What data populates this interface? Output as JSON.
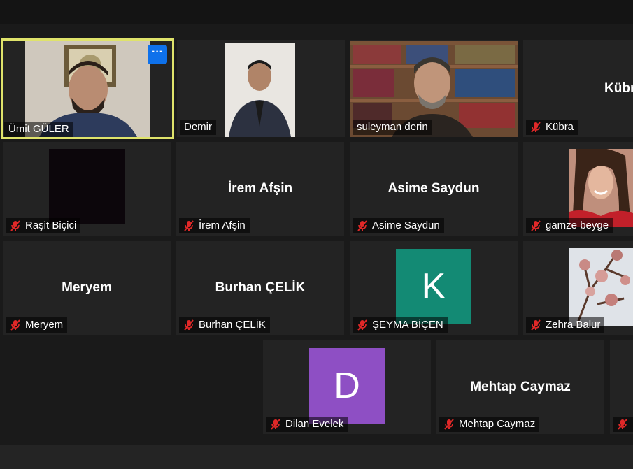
{
  "participants": {
    "umit": {
      "label": "Ümit GÜLER"
    },
    "demir": {
      "label": "Demir"
    },
    "suleyman": {
      "label": "suleyman derin"
    },
    "kubra": {
      "label": "Kübra",
      "center": "Kübra"
    },
    "rasit": {
      "label": "Raşit Biçici"
    },
    "irem": {
      "label": "İrem Afşin",
      "center": "İrem Afşin"
    },
    "asime": {
      "label": "Asime Saydun",
      "center": "Asime Saydun"
    },
    "gamze": {
      "label": "gamze beyge"
    },
    "meryem": {
      "label": "Meryem",
      "center": "Meryem"
    },
    "burhan": {
      "label": "Burhan ÇELİK",
      "center": "Burhan ÇELİK"
    },
    "seyma": {
      "label": "ŞEYMA BİÇEN",
      "avatar_letter": "K",
      "avatar_color": "#138a74"
    },
    "zehra": {
      "label": "Zehra Balur"
    },
    "dilan": {
      "label": "Dilan Evelek",
      "avatar_letter": "D",
      "avatar_color": "#8e4fc4"
    },
    "mehtap": {
      "label": "Mehtap Caymaz",
      "center": "Mehtap Caymaz"
    }
  },
  "more_button": {
    "label": "···"
  },
  "colors": {
    "active_border": "#dfe36b",
    "mute_icon": "#e02828",
    "tile_bg": "#232323"
  }
}
